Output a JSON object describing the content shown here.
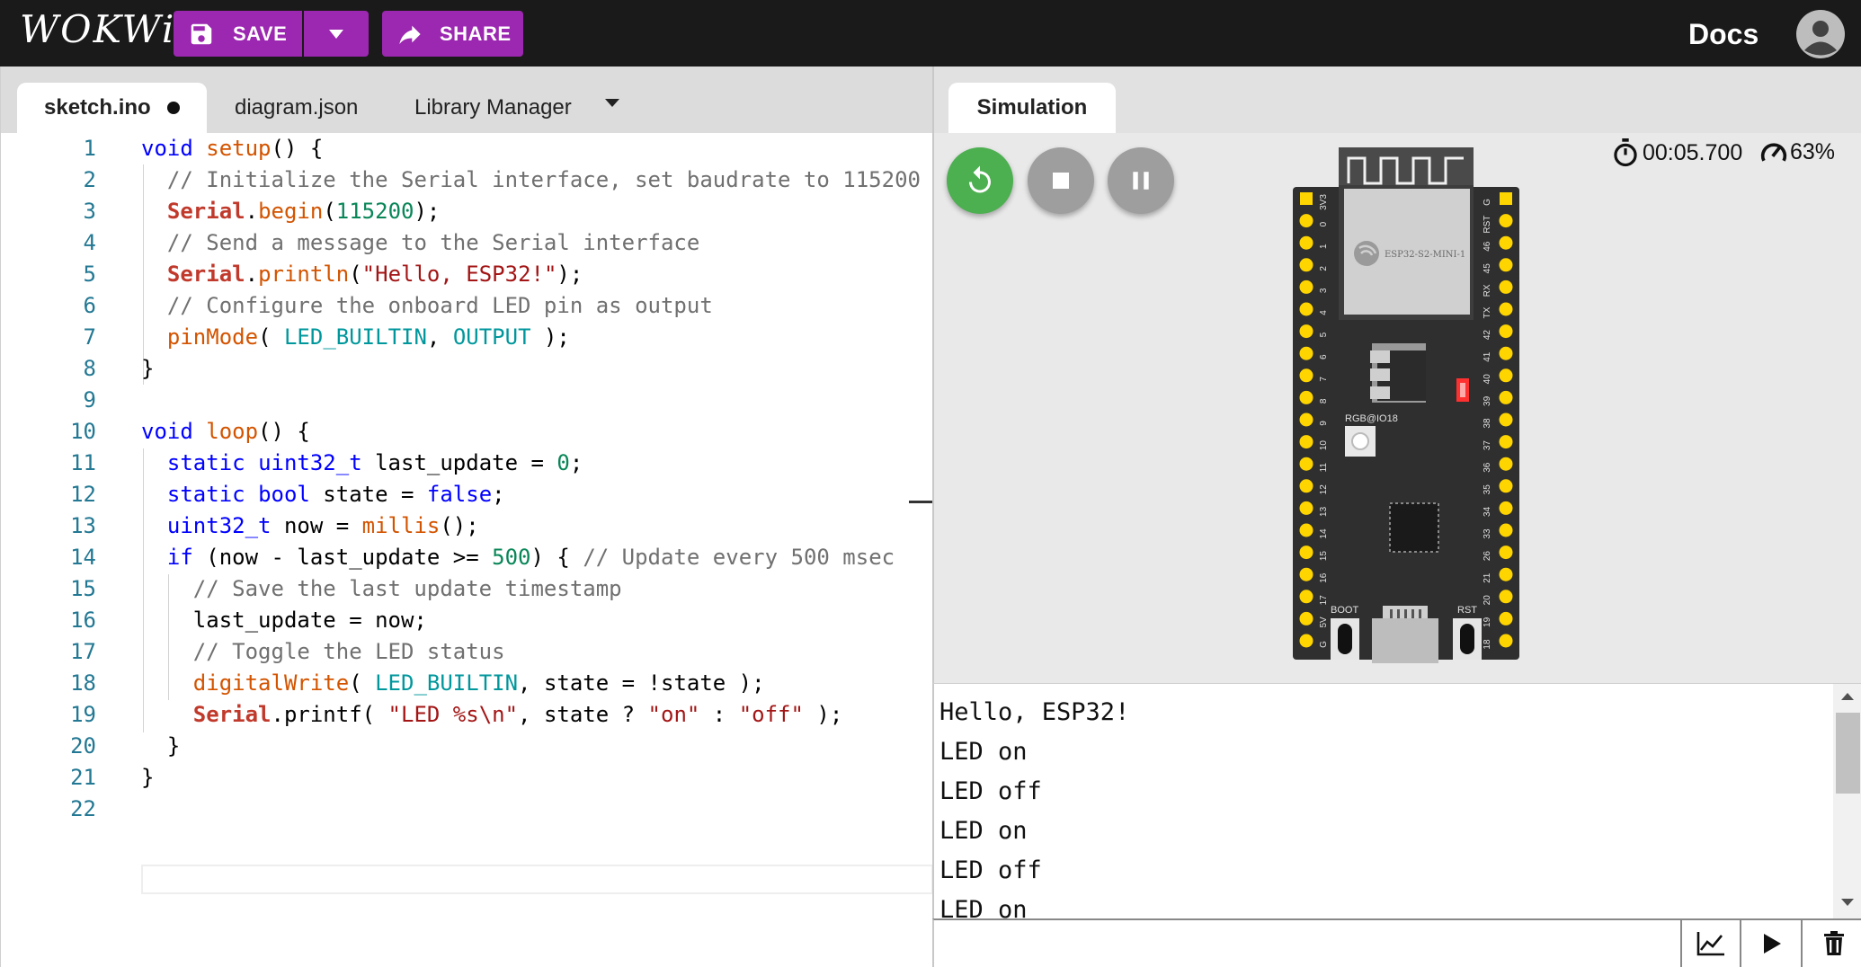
{
  "header": {
    "logo": "WOKWi",
    "save_label": "SAVE",
    "share_label": "SHARE",
    "docs_label": "Docs"
  },
  "editor": {
    "tabs": [
      {
        "label": "sketch.ino",
        "active": true,
        "modified": true
      },
      {
        "label": "diagram.json",
        "active": false
      },
      {
        "label": "Library Manager",
        "active": false
      }
    ],
    "line_numbers": [
      "1",
      "2",
      "3",
      "4",
      "5",
      "6",
      "7",
      "8",
      "9",
      "10",
      "11",
      "12",
      "13",
      "14",
      "15",
      "16",
      "17",
      "18",
      "19",
      "20",
      "21",
      "22"
    ],
    "code_lines": [
      "void setup() {",
      "  // Initialize the Serial interface, set baudrate to 115200",
      "  Serial.begin(115200);",
      "  // Send a message to the Serial interface",
      "  Serial.println(\"Hello, ESP32!\");",
      "  // Configure the onboard LED pin as output",
      "  pinMode( LED_BUILTIN, OUTPUT );",
      "}",
      "",
      "void loop() {",
      "  static uint32_t last_update = 0;",
      "  static bool state = false;",
      "  uint32_t now = millis();",
      "  if (now - last_update >= 500) { // Update every 500 msec",
      "    // Save the last update timestamp",
      "    last_update = now;",
      "    // Toggle the LED status",
      "    digitalWrite( LED_BUILTIN, state = !state );",
      "    Serial.printf( \"LED %s\\n\", state ? \"on\" : \"off\" );",
      "  }",
      "}",
      ""
    ]
  },
  "simulation": {
    "tab_label": "Simulation",
    "timer": "00:05.700",
    "speed": "63%",
    "board": {
      "module_label": "ESP32-S2-MINI-1",
      "rgb_label": "RGB@IO18",
      "boot_label": "BOOT",
      "rst_label": "RST",
      "left_pins": [
        "3V3",
        "0",
        "1",
        "2",
        "3",
        "4",
        "5",
        "6",
        "7",
        "8",
        "9",
        "10",
        "11",
        "12",
        "13",
        "14",
        "15",
        "16",
        "17",
        "5V",
        "G"
      ],
      "right_pins": [
        "G",
        "RST",
        "46",
        "45",
        "RX",
        "TX",
        "42",
        "41",
        "40",
        "39",
        "38",
        "37",
        "36",
        "35",
        "34",
        "33",
        "26",
        "21",
        "20",
        "19",
        "18"
      ]
    }
  },
  "serial_monitor": {
    "lines": [
      "Hello, ESP32!",
      "LED on",
      "LED off",
      "LED on",
      "LED off",
      "LED on"
    ],
    "input_value": ""
  },
  "colors": {
    "accent": "#9c27b0",
    "topbar": "#1a1a1a",
    "restart_button": "#4caf50",
    "control_button": "#9e9e9e",
    "pin": "#ffd500",
    "board": "#2f2f2f",
    "led_red": "#ff3030"
  }
}
